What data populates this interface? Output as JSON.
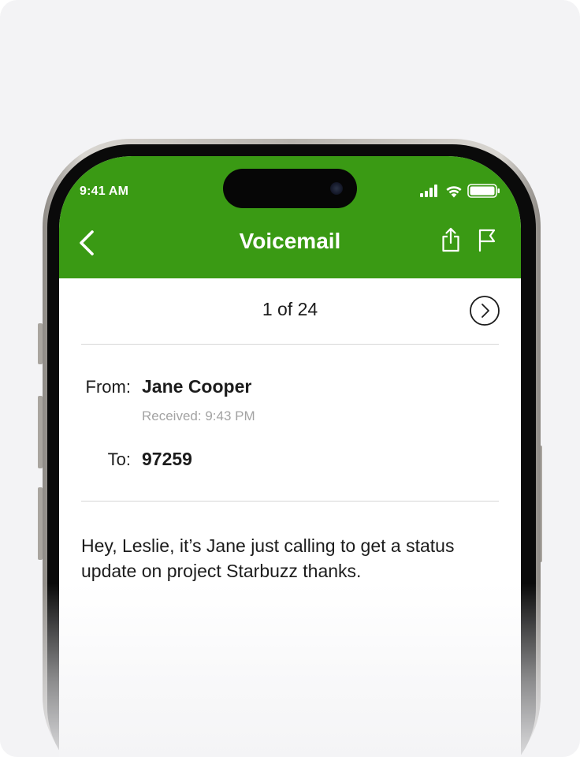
{
  "status_bar": {
    "time": "9:41 AM"
  },
  "nav": {
    "title": "Voicemail",
    "back_icon": "chevron-left-icon",
    "share_icon": "share-icon",
    "flag_icon": "flag-icon"
  },
  "pager": {
    "text": "1 of 24",
    "next_icon": "chevron-right-circle-icon"
  },
  "details": {
    "from_label": "From:",
    "from_value": "Jane Cooper",
    "received": "Received: 9:43 PM",
    "to_label": "To:",
    "to_value": "97259"
  },
  "message": {
    "text": "Hey, Leslie, it’s Jane just calling to get a status update on project Starbuzz thanks."
  },
  "colors": {
    "header_green": "#3a9a14",
    "background": "#f3f3f5"
  }
}
